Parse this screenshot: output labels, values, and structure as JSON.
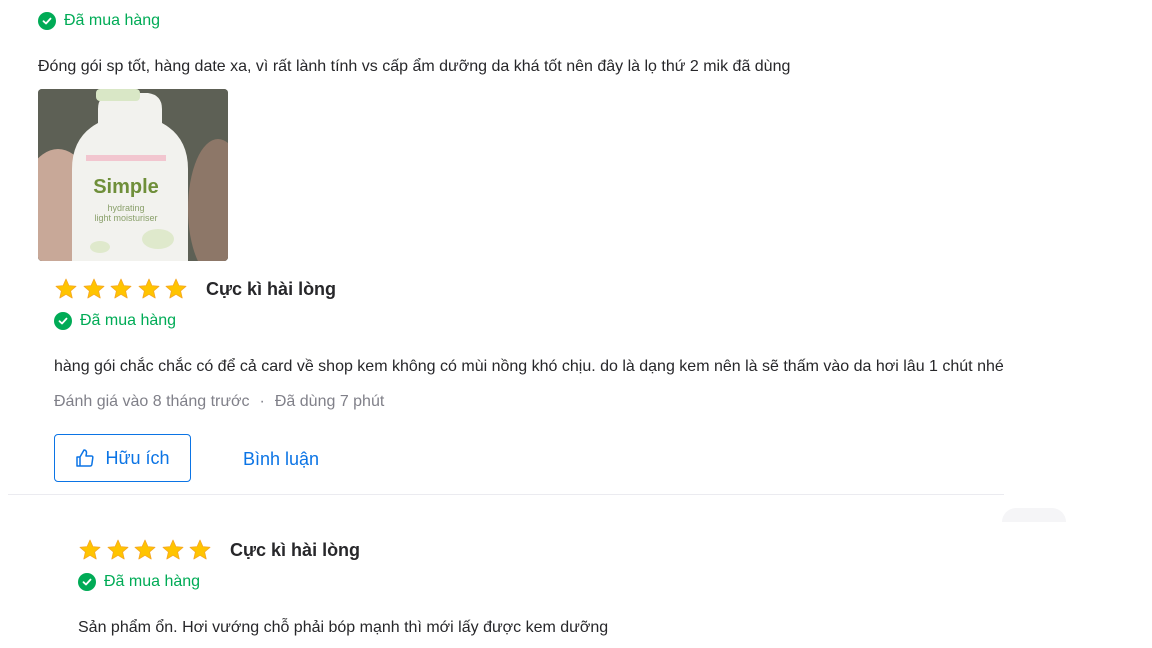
{
  "review1": {
    "verified_label": "Đã mua hàng",
    "content": "Đóng gói sp tốt, hàng date xa, vì rất lành tính vs cấp ẩm dưỡng da khá tốt nên đây là lọ thứ 2 mik đã dùng",
    "photo": {
      "brand": "Simple",
      "line1": "hydrating",
      "line2": "light moisturiser"
    }
  },
  "review2": {
    "stars": 5,
    "rating_label": "Cực kì hài lòng",
    "verified_label": "Đã mua hàng",
    "content": "hàng gói chắc chắc có để cả card về shop kem không có mùi nồng khó chịu. do là dạng kem nên là sẽ thấm vào da hơi lâu 1 chút nhé",
    "reviewed_time": "Đánh giá vào 8 tháng trước",
    "separator": "·",
    "usage_time": "Đã dùng 7 phút",
    "helpful_label": "Hữu ích",
    "comment_label": "Bình luận"
  },
  "review3": {
    "stars": 5,
    "rating_label": "Cực kì hài lòng",
    "verified_label": "Đã mua hàng",
    "content": "Sản phẩm ổn. Hơi vướng chỗ phải bóp mạnh thì mới lấy được kem dưỡng"
  },
  "colors": {
    "verified_green": "#00ab56",
    "star_yellow": "#ffc400",
    "link_blue": "#0b74e5",
    "meta_gray": "#808089"
  }
}
